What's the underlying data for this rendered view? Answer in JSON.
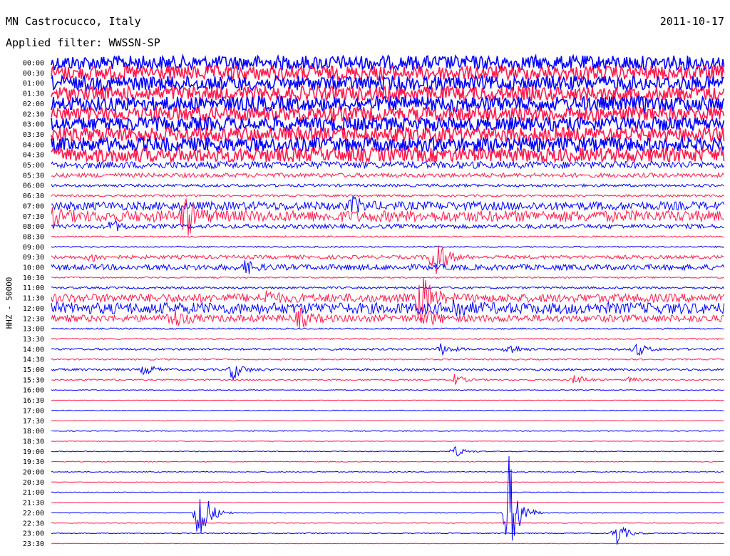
{
  "header": {
    "station": "MN Castrocucco, Italy",
    "date": "2011-10-17",
    "filter": "Applied filter: WWSSN-SP"
  },
  "chart_data": {
    "type": "line",
    "title": "MN Castrocucco, Italy",
    "subtitle": "Applied filter: WWSSN-SP",
    "date": "2011-10-17",
    "ylabel": "HHZ - 50000",
    "xlabel": "",
    "grid": false,
    "legend": "none",
    "colors": [
      "#0000ff",
      "#ff1a4d"
    ],
    "row_labels": [
      "00:00",
      "00:30",
      "01:00",
      "01:30",
      "02:00",
      "02:30",
      "03:00",
      "03:30",
      "04:00",
      "04:30",
      "05:00",
      "05:30",
      "06:00",
      "06:30",
      "07:00",
      "07:30",
      "08:00",
      "08:30",
      "09:00",
      "09:30",
      "10:00",
      "10:30",
      "11:00",
      "11:30",
      "12:00",
      "12:30",
      "13:00",
      "13:30",
      "14:00",
      "14:30",
      "15:00",
      "15:30",
      "16:00",
      "16:30",
      "17:00",
      "17:30",
      "18:00",
      "18:30",
      "19:00",
      "19:30",
      "20:00",
      "20:30",
      "21:00",
      "21:30",
      "22:00",
      "22:30",
      "23:00",
      "23:30"
    ],
    "row_noise_level": [
      10,
      10,
      10,
      10,
      10,
      10,
      10,
      10,
      10,
      10,
      5,
      3,
      2,
      1.5,
      6,
      8,
      3,
      1,
      1,
      2.5,
      4,
      1,
      1.5,
      6,
      8,
      5,
      1,
      1,
      1.5,
      1,
      1.5,
      1,
      0.6,
      0.4,
      0.6,
      0.4,
      0.6,
      0.4,
      0.6,
      0.6,
      0.6,
      0.4,
      0.6,
      0.4,
      0.6,
      0.4,
      0.6,
      0.4
    ],
    "events": [
      {
        "row": 4,
        "x": 0.31,
        "amp": 3
      },
      {
        "row": 4,
        "x": 0.6,
        "amp": 4
      },
      {
        "row": 4,
        "x": 0.88,
        "amp": 3
      },
      {
        "row": 15,
        "x": 0.2,
        "amp": 30
      },
      {
        "row": 15,
        "x": 0.0,
        "amp": 8
      },
      {
        "row": 14,
        "x": 0.45,
        "amp": 10
      },
      {
        "row": 16,
        "x": 0.09,
        "amp": 8
      },
      {
        "row": 19,
        "x": 0.57,
        "amp": 40
      },
      {
        "row": 19,
        "x": 0.06,
        "amp": 6
      },
      {
        "row": 20,
        "x": 0.29,
        "amp": 8
      },
      {
        "row": 23,
        "x": 0.32,
        "amp": 8
      },
      {
        "row": 23,
        "x": 0.55,
        "amp": 40
      },
      {
        "row": 24,
        "x": 0.6,
        "amp": 12
      },
      {
        "row": 25,
        "x": 0.18,
        "amp": 14
      },
      {
        "row": 25,
        "x": 0.37,
        "amp": 12
      },
      {
        "row": 25,
        "x": 0.56,
        "amp": 10
      },
      {
        "row": 28,
        "x": 0.58,
        "amp": 8
      },
      {
        "row": 28,
        "x": 0.68,
        "amp": 8
      },
      {
        "row": 28,
        "x": 0.87,
        "amp": 10
      },
      {
        "row": 30,
        "x": 0.14,
        "amp": 8
      },
      {
        "row": 30,
        "x": 0.27,
        "amp": 14
      },
      {
        "row": 31,
        "x": 0.6,
        "amp": 8
      },
      {
        "row": 31,
        "x": 0.78,
        "amp": 8
      },
      {
        "row": 31,
        "x": 0.86,
        "amp": 4
      },
      {
        "row": 38,
        "x": 0.6,
        "amp": 8
      },
      {
        "row": 44,
        "x": 0.22,
        "amp": 55
      },
      {
        "row": 44,
        "x": 0.68,
        "amp": 80
      },
      {
        "row": 46,
        "x": 0.84,
        "amp": 18
      }
    ]
  }
}
